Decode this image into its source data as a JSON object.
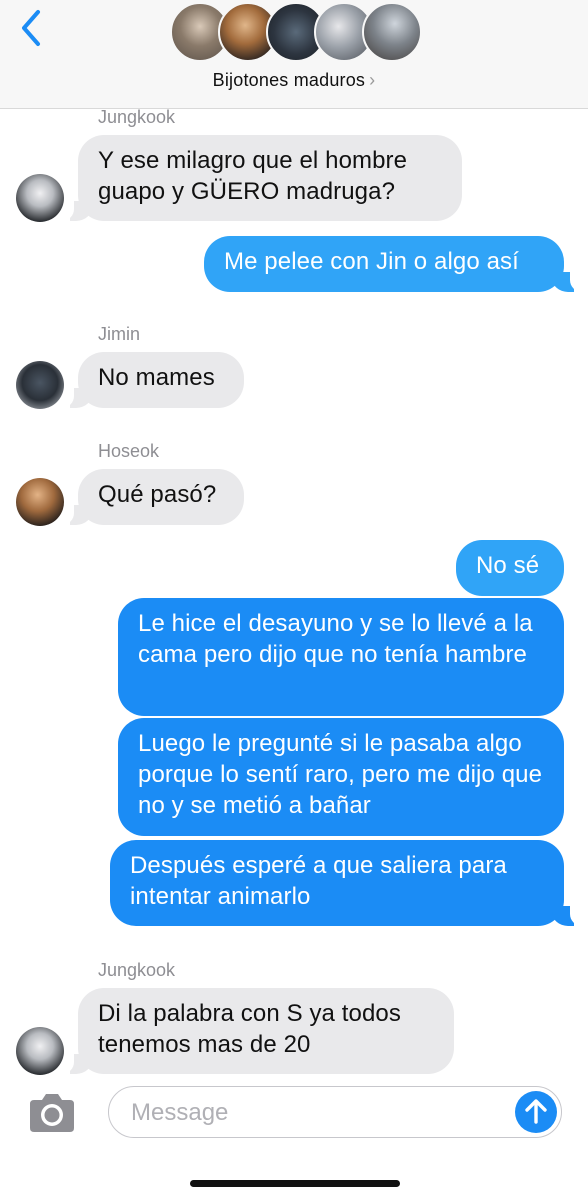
{
  "header": {
    "group_name": "Bijotones maduros",
    "chevron": "›",
    "back_icon": "chevron-left-icon",
    "accent_color": "#1b8cf5"
  },
  "messages": [
    {
      "sender": "Jungkook",
      "text": "Y ese milagro que el hombre guapo y GÜERO madruga?",
      "direction": "incoming"
    },
    {
      "text": "Me pelee con Jin o algo así",
      "direction": "outgoing"
    },
    {
      "sender": "Jimin",
      "text": "No mames",
      "direction": "incoming"
    },
    {
      "sender": "Hoseok",
      "text": "Qué pasó?",
      "direction": "incoming"
    },
    {
      "text": "No sé",
      "direction": "outgoing"
    },
    {
      "text": "Le hice el desayuno y se lo llevé a la cama pero dijo que no tenía hambre",
      "direction": "outgoing"
    },
    {
      "text": "Luego le pregunté si le pasaba algo porque lo sentí raro, pero me dijo que no y se metió a bañar",
      "direction": "outgoing"
    },
    {
      "text": "Después esperé a que saliera para intentar animarlo",
      "direction": "outgoing"
    },
    {
      "sender": "Jungkook",
      "text": "Di la palabra con S ya todos tenemos mas de 20",
      "direction": "incoming"
    }
  ],
  "composer": {
    "placeholder": "Message",
    "camera_icon": "camera-icon",
    "send_icon": "send-arrow-icon"
  }
}
